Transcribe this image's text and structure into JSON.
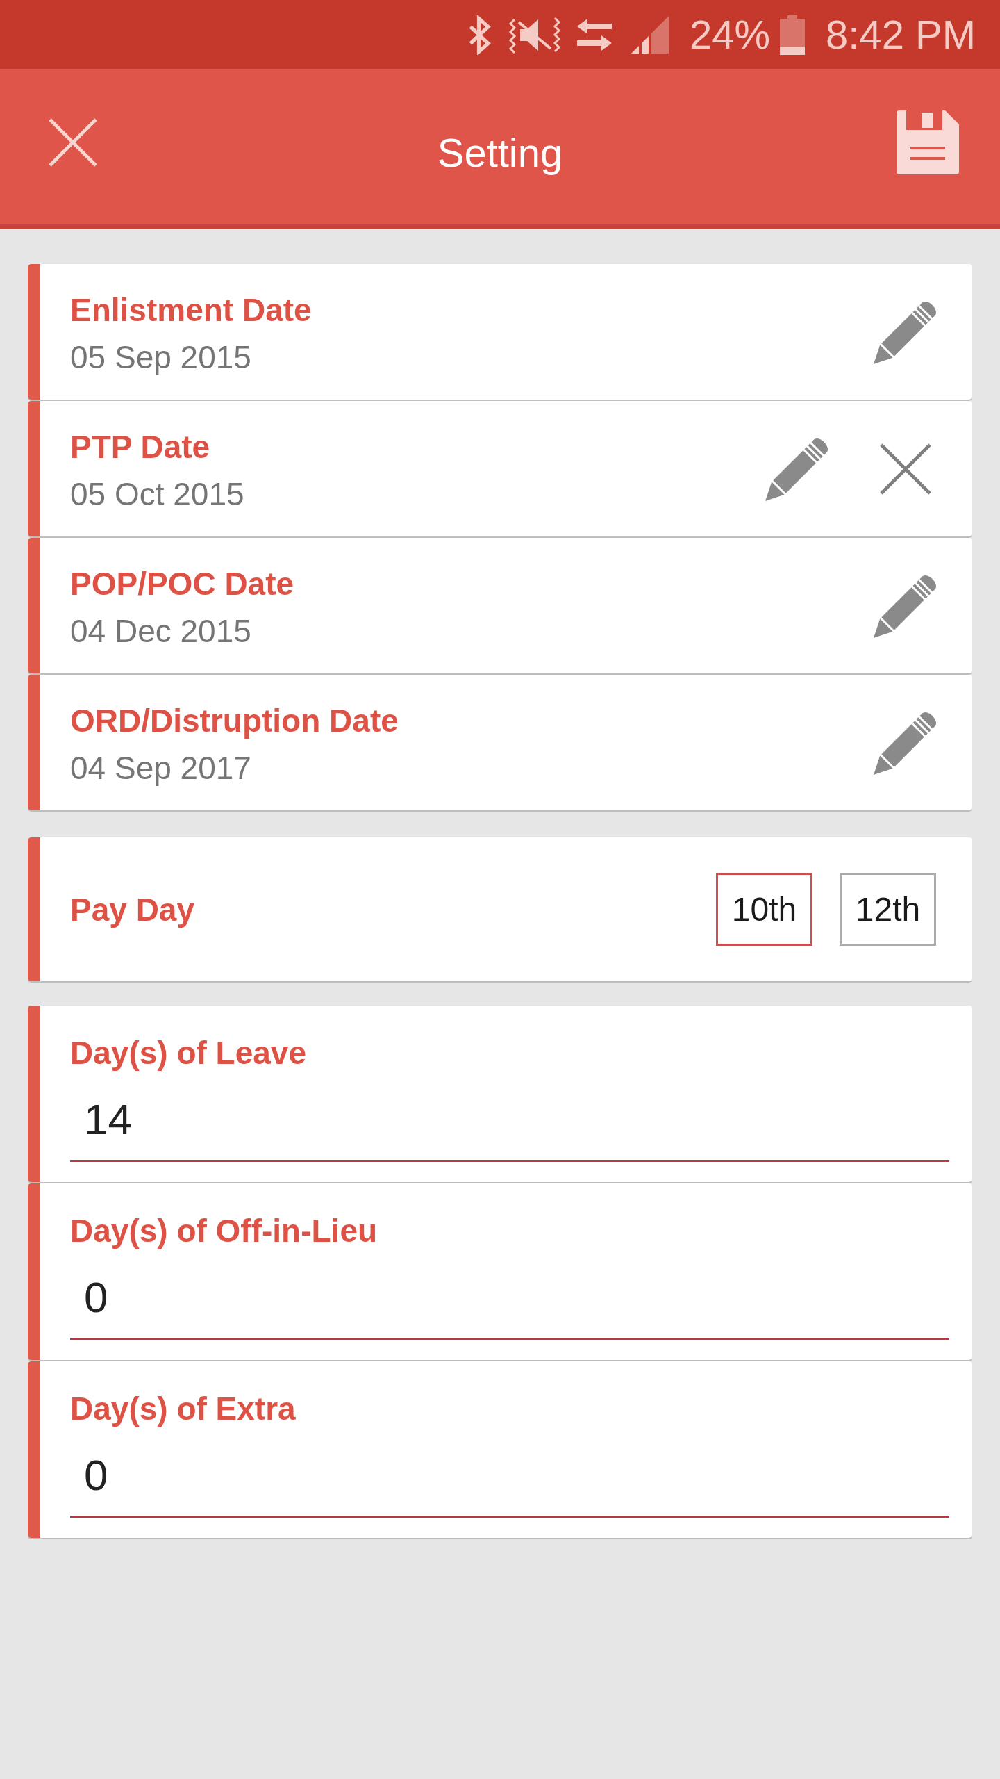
{
  "status_bar": {
    "battery": "24%",
    "time": "8:42 PM"
  },
  "app_bar": {
    "title": "Setting"
  },
  "date_settings": [
    {
      "label": "Enlistment Date",
      "value": "05 Sep 2015",
      "clearable": false
    },
    {
      "label": "PTP Date",
      "value": "05 Oct 2015",
      "clearable": true
    },
    {
      "label": "POP/POC Date",
      "value": "04 Dec 2015",
      "clearable": false
    },
    {
      "label": "ORD/Distruption Date",
      "value": "04 Sep 2017",
      "clearable": false
    }
  ],
  "pay_day": {
    "label": "Pay Day",
    "options": [
      {
        "label": "10th",
        "selected": true
      },
      {
        "label": "12th",
        "selected": false
      }
    ]
  },
  "day_counts": [
    {
      "label": "Day(s) of Leave",
      "value": "14"
    },
    {
      "label": "Day(s) of Off-in-Lieu",
      "value": "0"
    },
    {
      "label": "Day(s) of Extra",
      "value": "0"
    }
  ]
}
